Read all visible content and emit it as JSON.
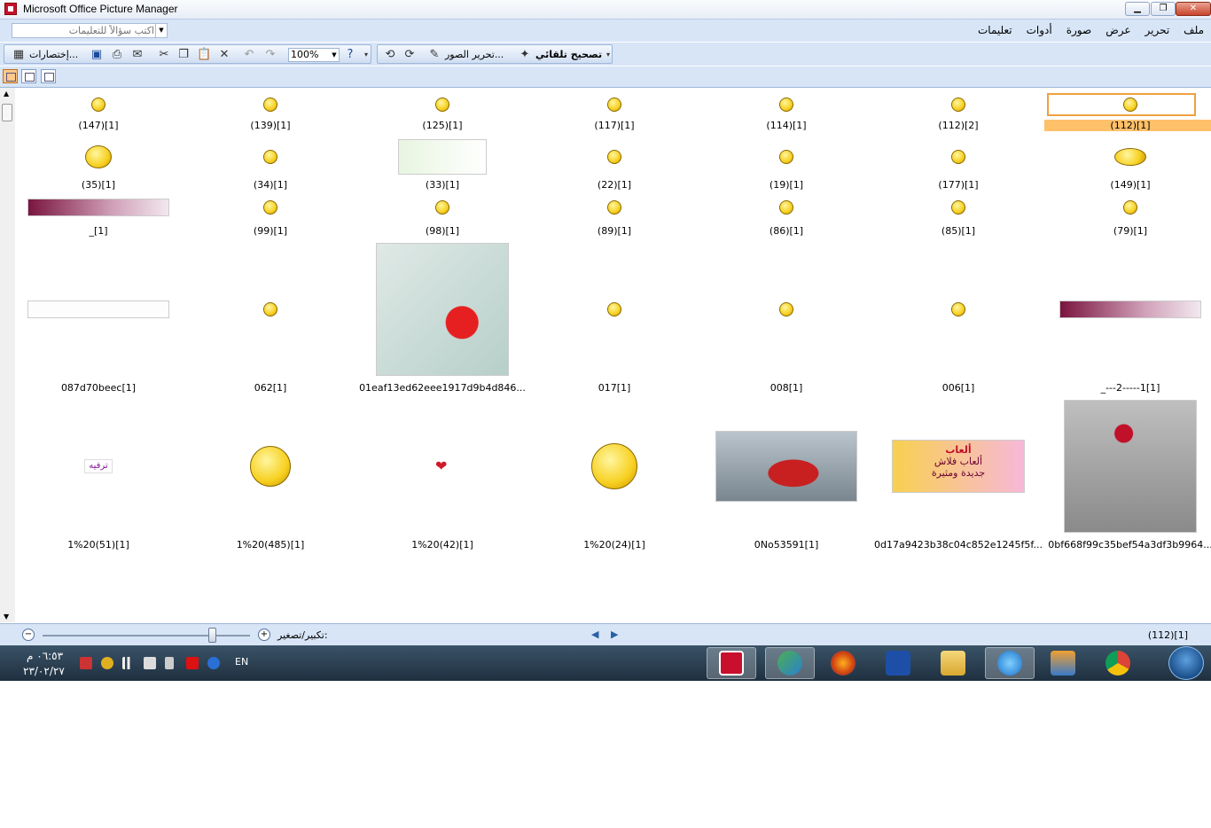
{
  "window": {
    "title": "Microsoft Office Picture Manager",
    "buttons": {
      "minimize": "▁",
      "restore": "❐",
      "close": "✕"
    }
  },
  "menu": {
    "items": [
      "ملف",
      "تحرير",
      "عرض",
      "صورة",
      "أدوات",
      "تعليمات"
    ],
    "help_placeholder": "اكتب سؤالاً للتعليمات"
  },
  "toolbar": {
    "shortcuts_label": "إختصارات...",
    "zoom_value": "100%",
    "edit_pictures_label": "تحرير الصور...",
    "auto_correct_label": "تصحيح تلقائي"
  },
  "gallery": {
    "items": [
      {
        "caption": "(112)[1]",
        "selected": true,
        "kind": "smiley"
      },
      {
        "caption": "(112)[2]",
        "kind": "smiley"
      },
      {
        "caption": "(114)[1]",
        "kind": "smiley"
      },
      {
        "caption": "(117)[1]",
        "kind": "smiley"
      },
      {
        "caption": "(125)[1]",
        "kind": "smiley"
      },
      {
        "caption": "(139)[1]",
        "kind": "smiley"
      },
      {
        "caption": "(147)[1]",
        "kind": "smiley"
      },
      {
        "caption": "(149)[1]",
        "kind": "smiley"
      },
      {
        "caption": "(177)[1]",
        "kind": "smiley"
      },
      {
        "caption": "(19)[1]",
        "kind": "smiley"
      },
      {
        "caption": "(22)[1]",
        "kind": "smiley"
      },
      {
        "caption": "(33)[1]",
        "kind": "image"
      },
      {
        "caption": "(34)[1]",
        "kind": "smiley"
      },
      {
        "caption": "(35)[1]",
        "kind": "smiley"
      },
      {
        "caption": "(79)[1]",
        "kind": "smiley"
      },
      {
        "caption": "(85)[1]",
        "kind": "smiley"
      },
      {
        "caption": "(86)[1]",
        "kind": "smiley"
      },
      {
        "caption": "(89)[1]",
        "kind": "smiley"
      },
      {
        "caption": "(98)[1]",
        "kind": "smiley"
      },
      {
        "caption": "(99)[1]",
        "kind": "smiley"
      },
      {
        "caption": "_[1]",
        "kind": "banner"
      },
      {
        "caption": "_---2-----1[1]",
        "kind": "banner"
      },
      {
        "caption": "006[1]",
        "kind": "smiley"
      },
      {
        "caption": "008[1]",
        "kind": "smiley"
      },
      {
        "caption": "017[1]",
        "kind": "smiley"
      },
      {
        "caption": "01eaf13ed62eee1917d9b4d846...",
        "kind": "hearts"
      },
      {
        "caption": "062[1]",
        "kind": "smiley"
      },
      {
        "caption": "087d70beec[1]",
        "kind": "banner"
      },
      {
        "caption": "0bf668f99c35bef54a3df3b9964...",
        "kind": "rose"
      },
      {
        "caption": "0d17a9423b38c04c852e1245f5f...",
        "kind": "games"
      },
      {
        "caption": "0No53591[1]",
        "kind": "truck"
      },
      {
        "caption": "1%20(24)[1]",
        "kind": "smiley"
      },
      {
        "caption": "1%20(42)[1]",
        "kind": "heart"
      },
      {
        "caption": "1%20(485)[1]",
        "kind": "smiley"
      },
      {
        "caption": "1%20(51)[1]",
        "kind": "label"
      }
    ],
    "games_banner_title": "ألعاب",
    "games_banner_line1": "ألعاب فلاش",
    "games_banner_line2": "جديدة ومثيرة",
    "label_text": "ترفيه"
  },
  "statusbar": {
    "zoom_label": "تكبير/تصغير:",
    "count": "(112)[1]"
  },
  "taskbar": {
    "time": "٠٦:٥٣ م",
    "date": "٢٣/٠٢/٢٧",
    "language": "EN"
  },
  "colors": {
    "chrome": "#d7e5f7",
    "selection": "#ffc06a",
    "taskbar": "#2b4256"
  }
}
